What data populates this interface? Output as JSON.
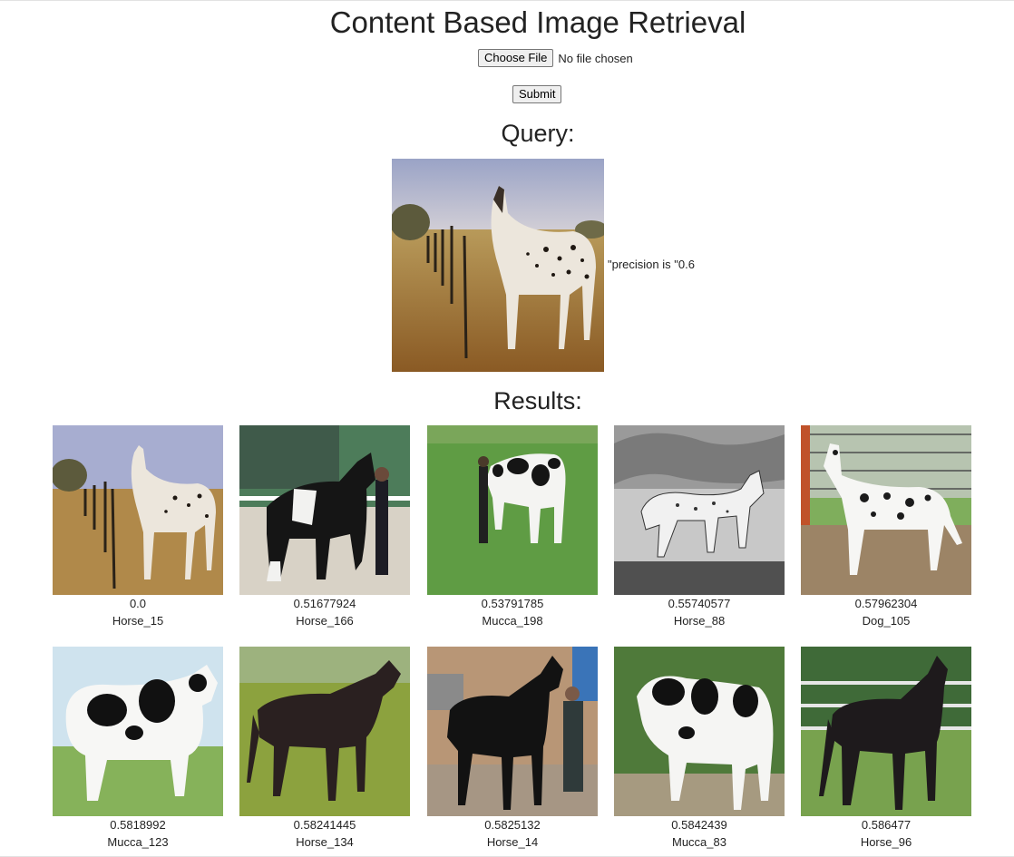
{
  "page": {
    "title": "Content Based Image Retrieval"
  },
  "upload": {
    "choose_label": "Choose File",
    "status": "No file chosen",
    "submit_label": "Submit"
  },
  "query": {
    "heading": "Query:",
    "image_alt": "query-horse-appaloosa",
    "precision_text": "\"precision is \"0.6"
  },
  "results": {
    "heading": "Results:",
    "items": [
      {
        "score": "0.0",
        "label": "Horse_15"
      },
      {
        "score": "0.51677924",
        "label": "Horse_166"
      },
      {
        "score": "0.53791785",
        "label": "Mucca_198"
      },
      {
        "score": "0.55740577",
        "label": "Horse_88"
      },
      {
        "score": "0.57962304",
        "label": "Dog_105"
      },
      {
        "score": "0.5818992",
        "label": "Mucca_123"
      },
      {
        "score": "0.58241445",
        "label": "Horse_134"
      },
      {
        "score": "0.5825132",
        "label": "Horse_14"
      },
      {
        "score": "0.5842439",
        "label": "Mucca_83"
      },
      {
        "score": "0.586477",
        "label": "Horse_96"
      }
    ]
  }
}
